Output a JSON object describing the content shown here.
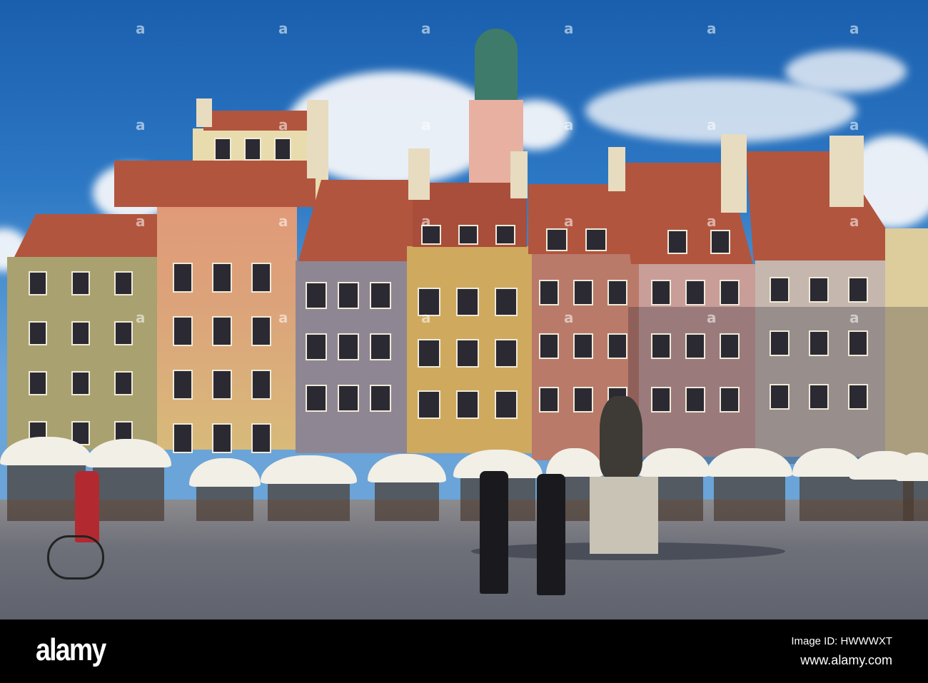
{
  "watermark": {
    "logo": "alamy",
    "image_id": "Image ID: HWWWXT",
    "url": "www.alamy.com"
  },
  "colors": {
    "sky": "#2d78c4",
    "roof": "#b2553e",
    "ground": "#6e7079",
    "bar": "#000000"
  }
}
